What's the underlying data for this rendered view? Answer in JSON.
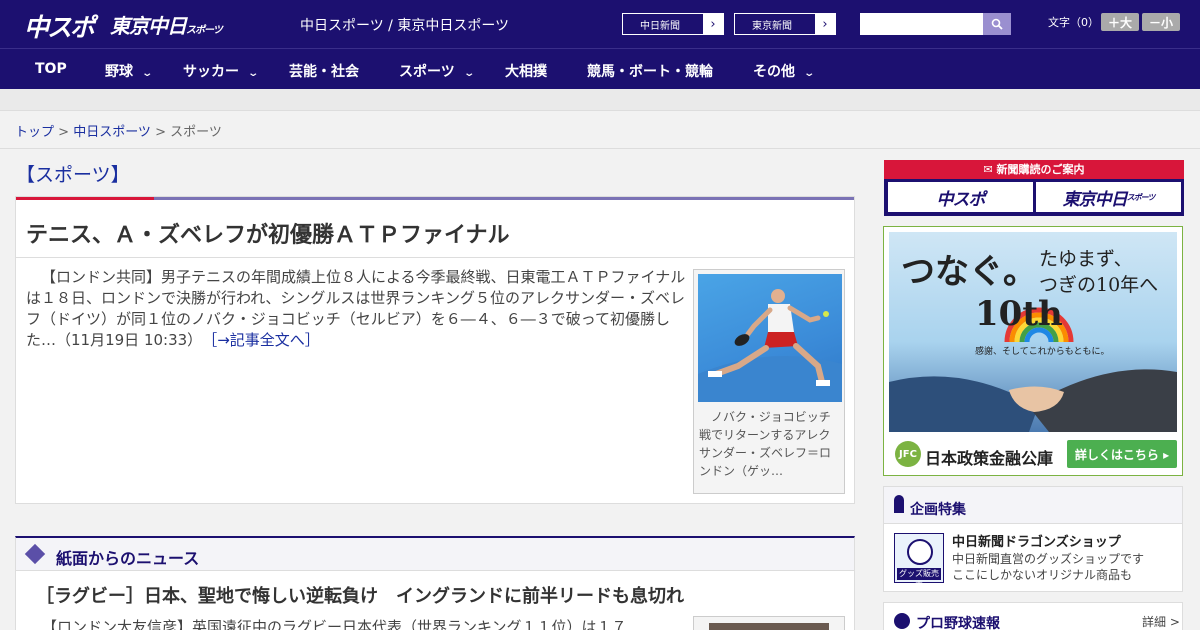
{
  "header": {
    "logo_chuspo": "中スポ",
    "logo_tokyo": "東京中日",
    "logo_tokyo_small": "スポーツ",
    "site_title": "中日スポーツ / 東京中日スポーツ",
    "paper_buttons": [
      "中日新聞",
      "東京新聞"
    ],
    "search_placeholder": "",
    "font_label": "文字（0）",
    "font_bigger": "＋大",
    "font_smaller": "－小"
  },
  "nav": {
    "items": [
      {
        "label": "TOP",
        "has_caret": false
      },
      {
        "label": "野球",
        "has_caret": true
      },
      {
        "label": "サッカー",
        "has_caret": true
      },
      {
        "label": "芸能・社会",
        "has_caret": false
      },
      {
        "label": "スポーツ",
        "has_caret": true
      },
      {
        "label": "大相撲",
        "has_caret": false
      },
      {
        "label": "競馬・ボート・競輪",
        "has_caret": false
      },
      {
        "label": "その他",
        "has_caret": true
      }
    ],
    "caret_glyph": "⌄"
  },
  "breadcrumb": {
    "items": [
      "トップ",
      "中日スポーツ",
      "スポーツ"
    ],
    "separator": " > "
  },
  "section_title": "【スポーツ】",
  "main_article": {
    "headline": "テニス、Ａ・ズベレフが初優勝ＡＴＰファイナル",
    "body": "【ロンドン共同】男子テニスの年間成績上位８人による今季最終戦、日東電工ＡＴＰファイナルは１８日、ロンドンで決勝が行われ、シングルスは世界ランキング５位のアレクサンダー・ズベレフ（ドイツ）が同１位のノバク・ジョコビッチ（セルビア）を６―４、６―３で破って初優勝した…（11月19日 10:33）",
    "more_link": "［→記事全文へ］",
    "photo_caption": "ノバク・ジョコビッチ戦でリターンするアレクサンダー・ズベレフ＝ロンドン（ゲッ…"
  },
  "news_section": {
    "title": "紙面からのニュース",
    "headline": "［ラグビー］日本、聖地で悔しい逆転負け　イングランドに前半リードも息切れ",
    "snippet": "【ロンドン大友信彦】英国遠征中のラグビー日本代表（世界ランキング１１位）は１７"
  },
  "sidebar": {
    "subscribe_head": "新聞購読のご案内",
    "subscribe_buttons": [
      "中スポ",
      "東京中日"
    ],
    "subscribe_small": "スポーツ",
    "ad": {
      "headline": "つなぐ。",
      "tagline_1": "たゆまず、",
      "tagline_2": "つぎの10年へ",
      "anniversary": "10th",
      "anniversary_sub": "感謝、そしてこれからもともに。",
      "jfc_logo": "JFC",
      "org_name": "日本政策金融公庫",
      "cta": "詳しくはこちら ▸"
    },
    "feature": {
      "title": "企画特集",
      "shop_logo_label": "グッズ販売中",
      "shop_title": "中日新聞ドラゴンズショップ",
      "shop_desc_1": "中日新聞直営のグッズショップです",
      "shop_desc_2": "ここにしかないオリジナル商品も"
    },
    "baseball": {
      "title": "プロ野球速報",
      "more": "詳細 >"
    }
  },
  "colors": {
    "brand_navy": "#1c1070",
    "accent_red": "#d8163a",
    "link_blue": "#1a2fa0",
    "ad_green": "#7cb342"
  }
}
